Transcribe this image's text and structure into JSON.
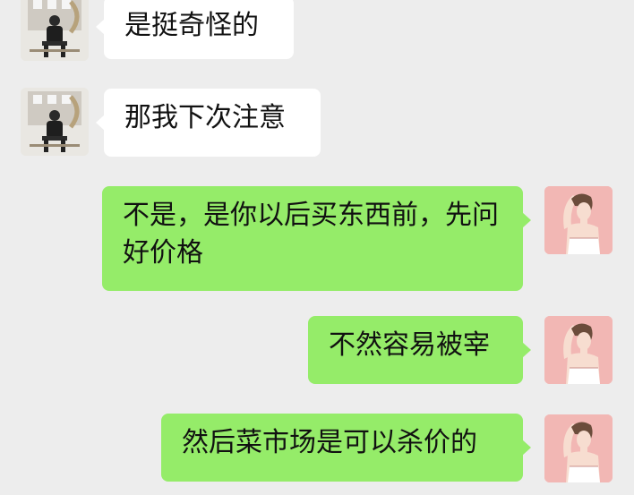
{
  "chat": {
    "messages": [
      {
        "side": "left",
        "text": "是挺奇怪的"
      },
      {
        "side": "left",
        "text": "那我下次注意"
      },
      {
        "side": "right",
        "text": "不是，是你以后买东西前，先问好价格"
      },
      {
        "side": "right",
        "text": "不然容易被宰"
      },
      {
        "side": "right",
        "text": "然后菜市场是可以杀价的"
      }
    ]
  },
  "colors": {
    "background": "#ededed",
    "incoming_bubble": "#ffffff",
    "outgoing_bubble": "#95ec69"
  },
  "icons": {
    "left_avatar": "person-photo-avatar",
    "right_avatar": "woman-illustration-avatar"
  }
}
